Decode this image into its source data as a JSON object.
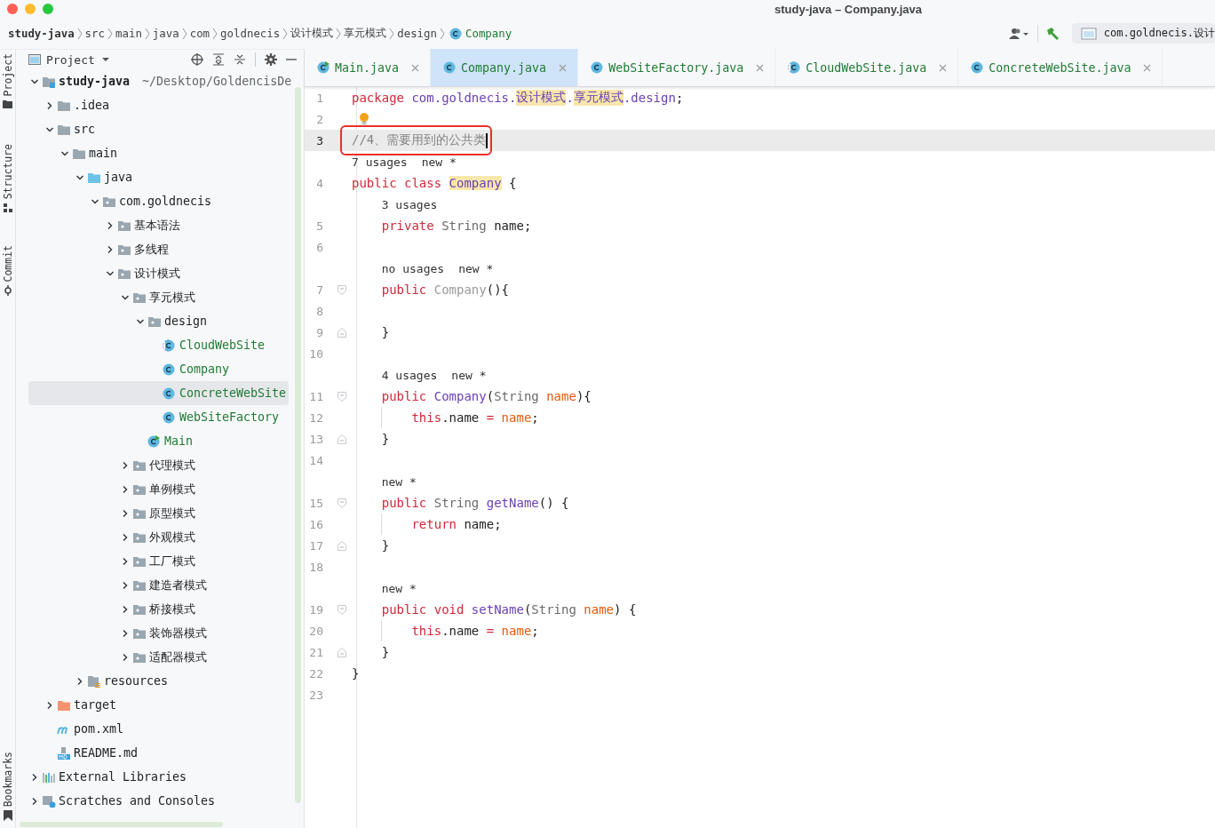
{
  "window": {
    "title": "study-java – Company.java"
  },
  "breadcrumbs": [
    {
      "label": "study-java",
      "kind": "project"
    },
    {
      "label": "src",
      "kind": "dir"
    },
    {
      "label": "main",
      "kind": "dir"
    },
    {
      "label": "java",
      "kind": "dir"
    },
    {
      "label": "com",
      "kind": "dir"
    },
    {
      "label": "goldnecis",
      "kind": "dir"
    },
    {
      "label": "设计模式",
      "kind": "dir"
    },
    {
      "label": "享元模式",
      "kind": "dir"
    },
    {
      "label": "design",
      "kind": "dir"
    },
    {
      "label": "Company",
      "kind": "class"
    }
  ],
  "toolbar": {
    "run_config": "com.goldnecis.设计"
  },
  "tool_strip": [
    {
      "label": "Project",
      "kind": "project"
    },
    {
      "label": "Structure",
      "kind": "structure"
    },
    {
      "label": "Commit",
      "kind": "commit"
    },
    {
      "label": "Bookmarks",
      "kind": "bookmarks"
    }
  ],
  "project_panel": {
    "title": "Project",
    "tree": [
      {
        "label": "study-java",
        "path": "~/Desktop/GoldencisDe",
        "kind": "module",
        "expanded": true,
        "selected": false,
        "children": [
          {
            "label": ".idea",
            "kind": "folder",
            "expanded": false,
            "selected": false
          },
          {
            "label": "src",
            "kind": "folder",
            "expanded": true,
            "selected": false,
            "children": [
              {
                "label": "main",
                "kind": "folder",
                "expanded": true,
                "selected": false,
                "children": [
                  {
                    "label": "java",
                    "kind": "source",
                    "expanded": true,
                    "selected": false,
                    "children": [
                      {
                        "label": "com.goldnecis",
                        "kind": "package",
                        "expanded": true,
                        "selected": false,
                        "children": [
                          {
                            "label": "基本语法",
                            "kind": "package",
                            "expanded": false,
                            "selected": false
                          },
                          {
                            "label": "多线程",
                            "kind": "package",
                            "expanded": false,
                            "selected": false
                          },
                          {
                            "label": "设计模式",
                            "kind": "package",
                            "expanded": true,
                            "selected": false,
                            "children": [
                              {
                                "label": "享元模式",
                                "kind": "package",
                                "expanded": true,
                                "selected": false,
                                "children": [
                                  {
                                    "label": "design",
                                    "kind": "package",
                                    "expanded": true,
                                    "selected": false,
                                    "children": [
                                      {
                                        "label": "CloudWebSite",
                                        "kind": "abstract",
                                        "selected": false
                                      },
                                      {
                                        "label": "Company",
                                        "kind": "class",
                                        "selected": false
                                      },
                                      {
                                        "label": "ConcreteWebSite",
                                        "kind": "class",
                                        "selected": true
                                      },
                                      {
                                        "label": "WebSiteFactory",
                                        "kind": "class",
                                        "selected": false
                                      }
                                    ]
                                  },
                                  {
                                    "label": "Main",
                                    "kind": "main",
                                    "selected": false
                                  }
                                ]
                              },
                              {
                                "label": "代理模式",
                                "kind": "package",
                                "expanded": false,
                                "selected": false
                              },
                              {
                                "label": "单例模式",
                                "kind": "package",
                                "expanded": false,
                                "selected": false
                              },
                              {
                                "label": "原型模式",
                                "kind": "package",
                                "expanded": false,
                                "selected": false
                              },
                              {
                                "label": "外观模式",
                                "kind": "package",
                                "expanded": false,
                                "selected": false
                              },
                              {
                                "label": "工厂模式",
                                "kind": "package",
                                "expanded": false,
                                "selected": false
                              },
                              {
                                "label": "建造者模式",
                                "kind": "package",
                                "expanded": false,
                                "selected": false
                              },
                              {
                                "label": "桥接模式",
                                "kind": "package",
                                "expanded": false,
                                "selected": false
                              },
                              {
                                "label": "装饰器模式",
                                "kind": "package",
                                "expanded": false,
                                "selected": false
                              },
                              {
                                "label": "适配器模式",
                                "kind": "package",
                                "expanded": false,
                                "selected": false
                              }
                            ]
                          }
                        ]
                      }
                    ]
                  },
                  {
                    "label": "resources",
                    "kind": "resources",
                    "expanded": false,
                    "selected": false
                  }
                ]
              }
            ]
          },
          {
            "label": "target",
            "kind": "target",
            "expanded": false,
            "selected": false
          },
          {
            "label": "pom.xml",
            "kind": "maven",
            "selected": false
          },
          {
            "label": "README.md",
            "kind": "markdown",
            "selected": false
          }
        ]
      },
      {
        "label": "External Libraries",
        "kind": "libraries",
        "expanded": false,
        "selected": false
      },
      {
        "label": "Scratches and Consoles",
        "kind": "scratches",
        "expanded": false,
        "selected": false
      }
    ]
  },
  "tabs": [
    {
      "label": "Main.java",
      "kind": "main",
      "selected": false
    },
    {
      "label": "Company.java",
      "kind": "class",
      "selected": true
    },
    {
      "label": "WebSiteFactory.java",
      "kind": "class",
      "selected": false
    },
    {
      "label": "CloudWebSite.java",
      "kind": "abstract",
      "selected": false
    },
    {
      "label": "ConcreteWebSite.java",
      "kind": "class",
      "selected": false
    }
  ],
  "editor": {
    "lines": [
      {
        "kind": "code",
        "number": "1",
        "tokens": [
          {
            "text": "package",
            "kind": "keyword"
          },
          {
            "text": " com.goldnecis.",
            "kind": "ident"
          },
          {
            "text": "设计模式",
            "kind": "ident-mark"
          },
          {
            "text": ".",
            "kind": "ident"
          },
          {
            "text": "享元模式",
            "kind": "ident-mark"
          },
          {
            "text": ".design",
            "kind": "ident"
          },
          {
            "text": ";",
            "kind": "plain"
          }
        ]
      },
      {
        "kind": "code",
        "number": "2",
        "intention": true
      },
      {
        "kind": "code",
        "number": "3",
        "current": true,
        "boxed": true,
        "caret": true,
        "tokens": [
          {
            "text": "//4、需要用到的公共类",
            "kind": "comment"
          }
        ]
      },
      {
        "kind": "hint",
        "hints": [
          "7 usages",
          "new *"
        ]
      },
      {
        "kind": "code",
        "number": "4",
        "tokens": [
          {
            "text": "public class ",
            "kind": "keyword"
          },
          {
            "text": "Company",
            "kind": "ident-mark"
          },
          {
            "text": " {",
            "kind": "plain"
          }
        ]
      },
      {
        "kind": "hint",
        "hints": [
          "3 usages"
        ]
      },
      {
        "kind": "code",
        "number": "5",
        "tokens": [
          {
            "text": "    private",
            "kind": "keyword"
          },
          {
            "text": " String",
            "kind": "type"
          },
          {
            "text": " name;",
            "kind": "plain"
          }
        ]
      },
      {
        "kind": "code",
        "number": "6"
      },
      {
        "kind": "hint",
        "hints": [
          "no usages",
          "new *"
        ]
      },
      {
        "kind": "code",
        "number": "7",
        "fold_start": true,
        "tokens": [
          {
            "text": "    public",
            "kind": "keyword"
          },
          {
            "text": " Company",
            "kind": "muted"
          },
          {
            "text": "(){",
            "kind": "plain"
          }
        ]
      },
      {
        "kind": "code",
        "number": "8"
      },
      {
        "kind": "code",
        "number": "9",
        "fold_end": true,
        "tokens": [
          {
            "text": "    }",
            "kind": "plain"
          }
        ]
      },
      {
        "kind": "code",
        "number": "10"
      },
      {
        "kind": "hint",
        "hints": [
          "4 usages",
          "new *"
        ]
      },
      {
        "kind": "code",
        "number": "11",
        "fold_start": true,
        "tokens": [
          {
            "text": "    public",
            "kind": "keyword"
          },
          {
            "text": " Company",
            "kind": "ident"
          },
          {
            "text": "(",
            "kind": "plain"
          },
          {
            "text": "String",
            "kind": "type"
          },
          {
            "text": " name",
            "kind": "param"
          },
          {
            "text": "){",
            "kind": "plain"
          }
        ]
      },
      {
        "kind": "code",
        "number": "12",
        "tokens": [
          {
            "text": "        this",
            "kind": "keyword"
          },
          {
            "text": ".name ",
            "kind": "plain"
          },
          {
            "text": "=",
            "kind": "keyword"
          },
          {
            "text": " name",
            "kind": "param"
          },
          {
            "text": ";",
            "kind": "plain"
          }
        ]
      },
      {
        "kind": "code",
        "number": "13",
        "fold_end": true,
        "tokens": [
          {
            "text": "    }",
            "kind": "plain"
          }
        ]
      },
      {
        "kind": "code",
        "number": "14"
      },
      {
        "kind": "hint",
        "hints": [
          "new *"
        ]
      },
      {
        "kind": "code",
        "number": "15",
        "fold_start": true,
        "tokens": [
          {
            "text": "    public",
            "kind": "keyword"
          },
          {
            "text": " String",
            "kind": "type"
          },
          {
            "text": " getName",
            "kind": "ident"
          },
          {
            "text": "() {",
            "kind": "plain"
          }
        ]
      },
      {
        "kind": "code",
        "number": "16",
        "tokens": [
          {
            "text": "        return",
            "kind": "keyword"
          },
          {
            "text": " name;",
            "kind": "plain"
          }
        ]
      },
      {
        "kind": "code",
        "number": "17",
        "fold_end": true,
        "tokens": [
          {
            "text": "    }",
            "kind": "plain"
          }
        ]
      },
      {
        "kind": "code",
        "number": "18"
      },
      {
        "kind": "hint",
        "hints": [
          "new *"
        ]
      },
      {
        "kind": "code",
        "number": "19",
        "fold_start": true,
        "tokens": [
          {
            "text": "    public void",
            "kind": "keyword"
          },
          {
            "text": " setName",
            "kind": "ident"
          },
          {
            "text": "(",
            "kind": "plain"
          },
          {
            "text": "String",
            "kind": "type"
          },
          {
            "text": " name",
            "kind": "param"
          },
          {
            "text": ") {",
            "kind": "plain"
          }
        ]
      },
      {
        "kind": "code",
        "number": "20",
        "tokens": [
          {
            "text": "        this",
            "kind": "keyword"
          },
          {
            "text": ".name ",
            "kind": "plain"
          },
          {
            "text": "=",
            "kind": "keyword"
          },
          {
            "text": " name",
            "kind": "param"
          },
          {
            "text": ";",
            "kind": "plain"
          }
        ]
      },
      {
        "kind": "code",
        "number": "21",
        "fold_end": true,
        "tokens": [
          {
            "text": "    }",
            "kind": "plain"
          }
        ]
      },
      {
        "kind": "code",
        "number": "22",
        "tokens": [
          {
            "text": "}",
            "kind": "plain"
          }
        ]
      },
      {
        "kind": "code",
        "number": "23"
      }
    ]
  }
}
